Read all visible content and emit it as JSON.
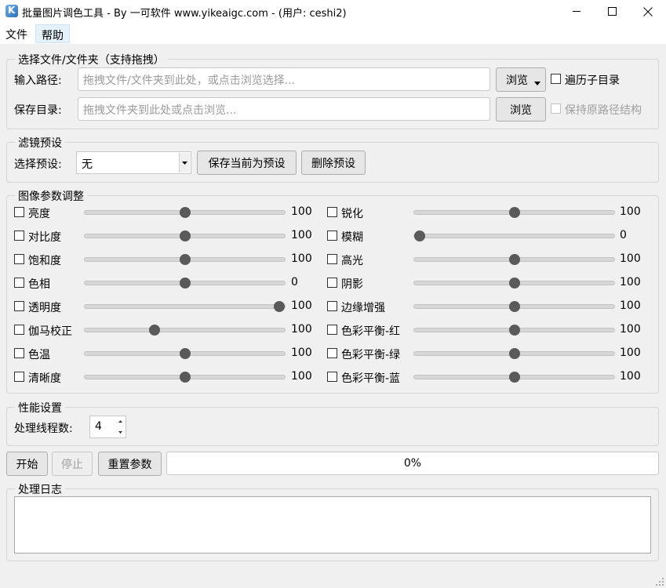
{
  "window": {
    "title": "批量图片调色工具 - By 一可软件 www.yikeaigc.com - (用户: ceshi2)"
  },
  "menu": {
    "file": "文件",
    "help": "帮助"
  },
  "files_group": {
    "title": "选择文件/文件夹（支持拖拽）",
    "input_label": "输入路径:",
    "input_placeholder": "拖拽文件/文件夹到此处，或点击浏览选择...",
    "browse_input": "浏览",
    "recursive_label": "遍历子目录",
    "save_label": "保存目录:",
    "save_placeholder": "拖拽文件夹到此处或点击浏览...",
    "browse_save": "浏览",
    "keep_structure_label": "保持原路径结构"
  },
  "preset_group": {
    "title": "滤镜预设",
    "select_label": "选择预设:",
    "selected": "无",
    "save_button": "保存当前为预设",
    "delete_button": "删除预设"
  },
  "params_group": {
    "title": "图像参数调整",
    "left": [
      {
        "label": "亮度",
        "value": "100",
        "fraction": 0.5
      },
      {
        "label": "对比度",
        "value": "100",
        "fraction": 0.5
      },
      {
        "label": "饱和度",
        "value": "100",
        "fraction": 0.5
      },
      {
        "label": "色相",
        "value": "0",
        "fraction": 0.5
      },
      {
        "label": "透明度",
        "value": "100",
        "fraction": 1.0
      },
      {
        "label": "伽马校正",
        "value": "100",
        "fraction": 0.34
      },
      {
        "label": "色温",
        "value": "100",
        "fraction": 0.5
      },
      {
        "label": "清晰度",
        "value": "100",
        "fraction": 0.5
      }
    ],
    "right": [
      {
        "label": "锐化",
        "value": "100",
        "fraction": 0.5
      },
      {
        "label": "模糊",
        "value": "0",
        "fraction": 0.0
      },
      {
        "label": "高光",
        "value": "100",
        "fraction": 0.5
      },
      {
        "label": "阴影",
        "value": "100",
        "fraction": 0.5
      },
      {
        "label": "边缘增强",
        "value": "100",
        "fraction": 0.5
      },
      {
        "label": "色彩平衡-红",
        "value": "100",
        "fraction": 0.5
      },
      {
        "label": "色彩平衡-绿",
        "value": "100",
        "fraction": 0.5
      },
      {
        "label": "色彩平衡-蓝",
        "value": "100",
        "fraction": 0.5
      }
    ]
  },
  "perf_group": {
    "title": "性能设置",
    "threads_label": "处理线程数:",
    "threads_value": "4"
  },
  "actions": {
    "start": "开始",
    "stop": "停止",
    "reset": "重置参数",
    "progress_text": "0%",
    "progress_fraction": 0.0
  },
  "log_group": {
    "title": "处理日志",
    "content": ""
  }
}
